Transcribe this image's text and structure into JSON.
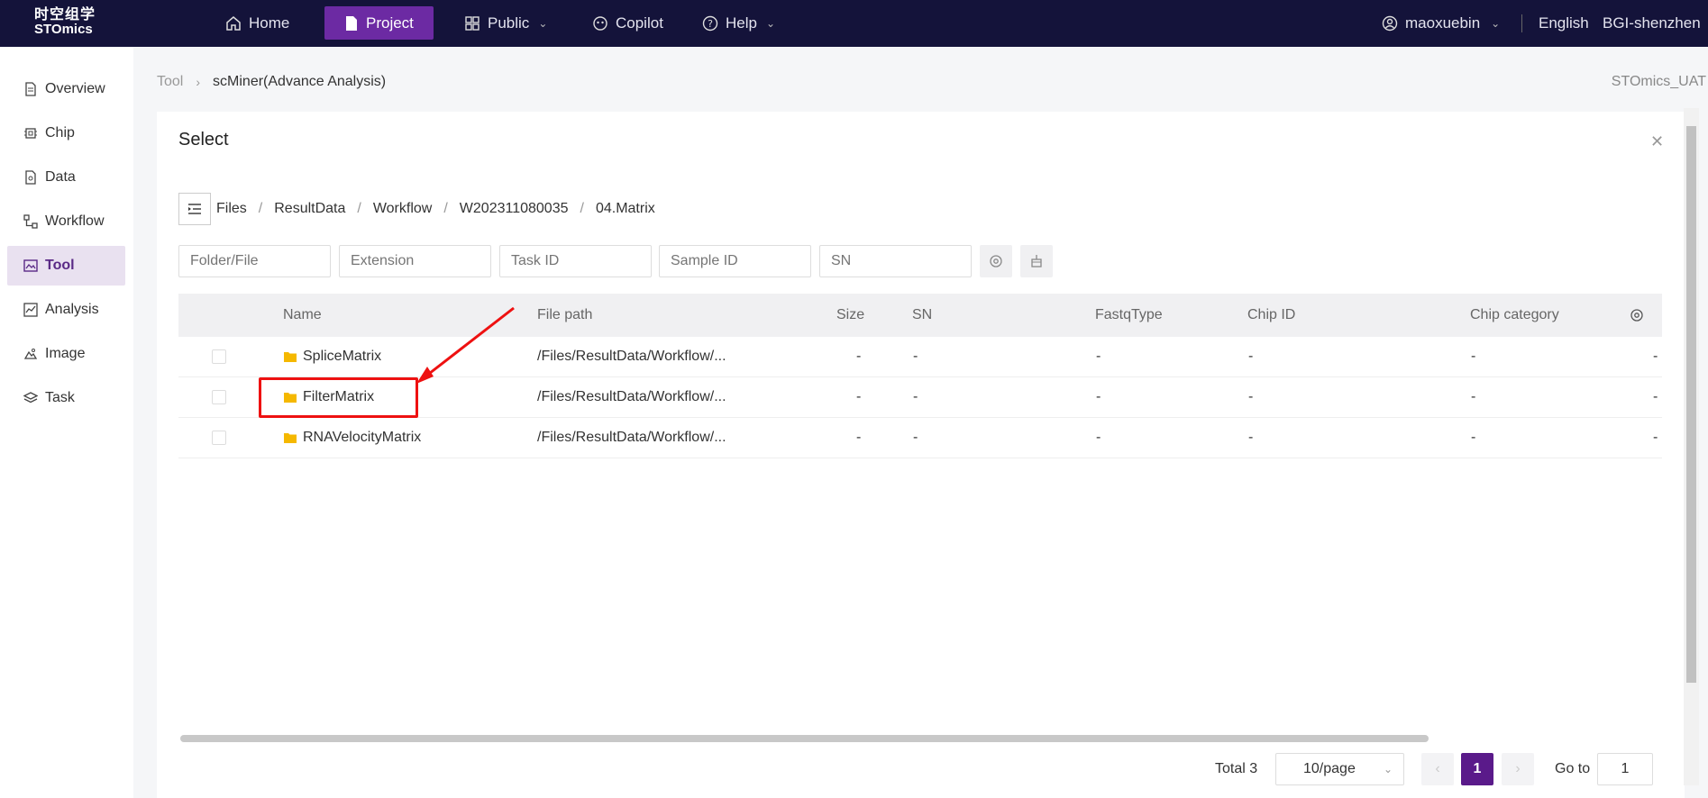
{
  "topbar": {
    "logo_line1": "时空组学",
    "logo_line2": "STOmics",
    "nav": [
      "Home",
      "Project",
      "Public",
      "Copilot",
      "Help"
    ],
    "user": "maoxuebin",
    "language": "English",
    "region": "BGI-shenzhen"
  },
  "sidebar": {
    "items": [
      "Overview",
      "Chip",
      "Data",
      "Workflow",
      "Tool",
      "Analysis",
      "Image",
      "Task"
    ],
    "active": "Tool"
  },
  "breadcrumb": {
    "root": "Tool",
    "current": "scMiner(Advance Analysis)"
  },
  "environment": "STOmics_UAT",
  "dialog": {
    "title": "Select",
    "path": [
      "Files",
      "ResultData",
      "Workflow",
      "W202311080035",
      "04.Matrix"
    ],
    "filters": {
      "folder_placeholder": "Folder/File",
      "extension_placeholder": "Extension",
      "task_placeholder": "Task ID",
      "sample_placeholder": "Sample ID",
      "sn_placeholder": "SN"
    },
    "columns": [
      "Name",
      "File path",
      "Size",
      "SN",
      "FastqType",
      "Chip ID",
      "Chip category"
    ],
    "rows": [
      {
        "name": "SpliceMatrix",
        "path": "/Files/ResultData/Workflow/...",
        "size": "-",
        "sn": "-",
        "fastq": "-",
        "chip_id": "-",
        "chip_cat": "-",
        "extra": "-"
      },
      {
        "name": "FilterMatrix",
        "path": "/Files/ResultData/Workflow/...",
        "size": "-",
        "sn": "-",
        "fastq": "-",
        "chip_id": "-",
        "chip_cat": "-",
        "extra": "-"
      },
      {
        "name": "RNAVelocityMatrix",
        "path": "/Files/ResultData/Workflow/...",
        "size": "-",
        "sn": "-",
        "fastq": "-",
        "chip_id": "-",
        "chip_cat": "-",
        "extra": "-"
      }
    ],
    "pagination": {
      "total": "Total 3",
      "page_size": "10/page",
      "current_page": "1",
      "goto_label": "Go to",
      "goto_value": "1"
    }
  },
  "colors": {
    "topbar": "#14133a",
    "accent": "#6c2aa3",
    "highlight": "#e11111",
    "folder": "#f5b800"
  }
}
